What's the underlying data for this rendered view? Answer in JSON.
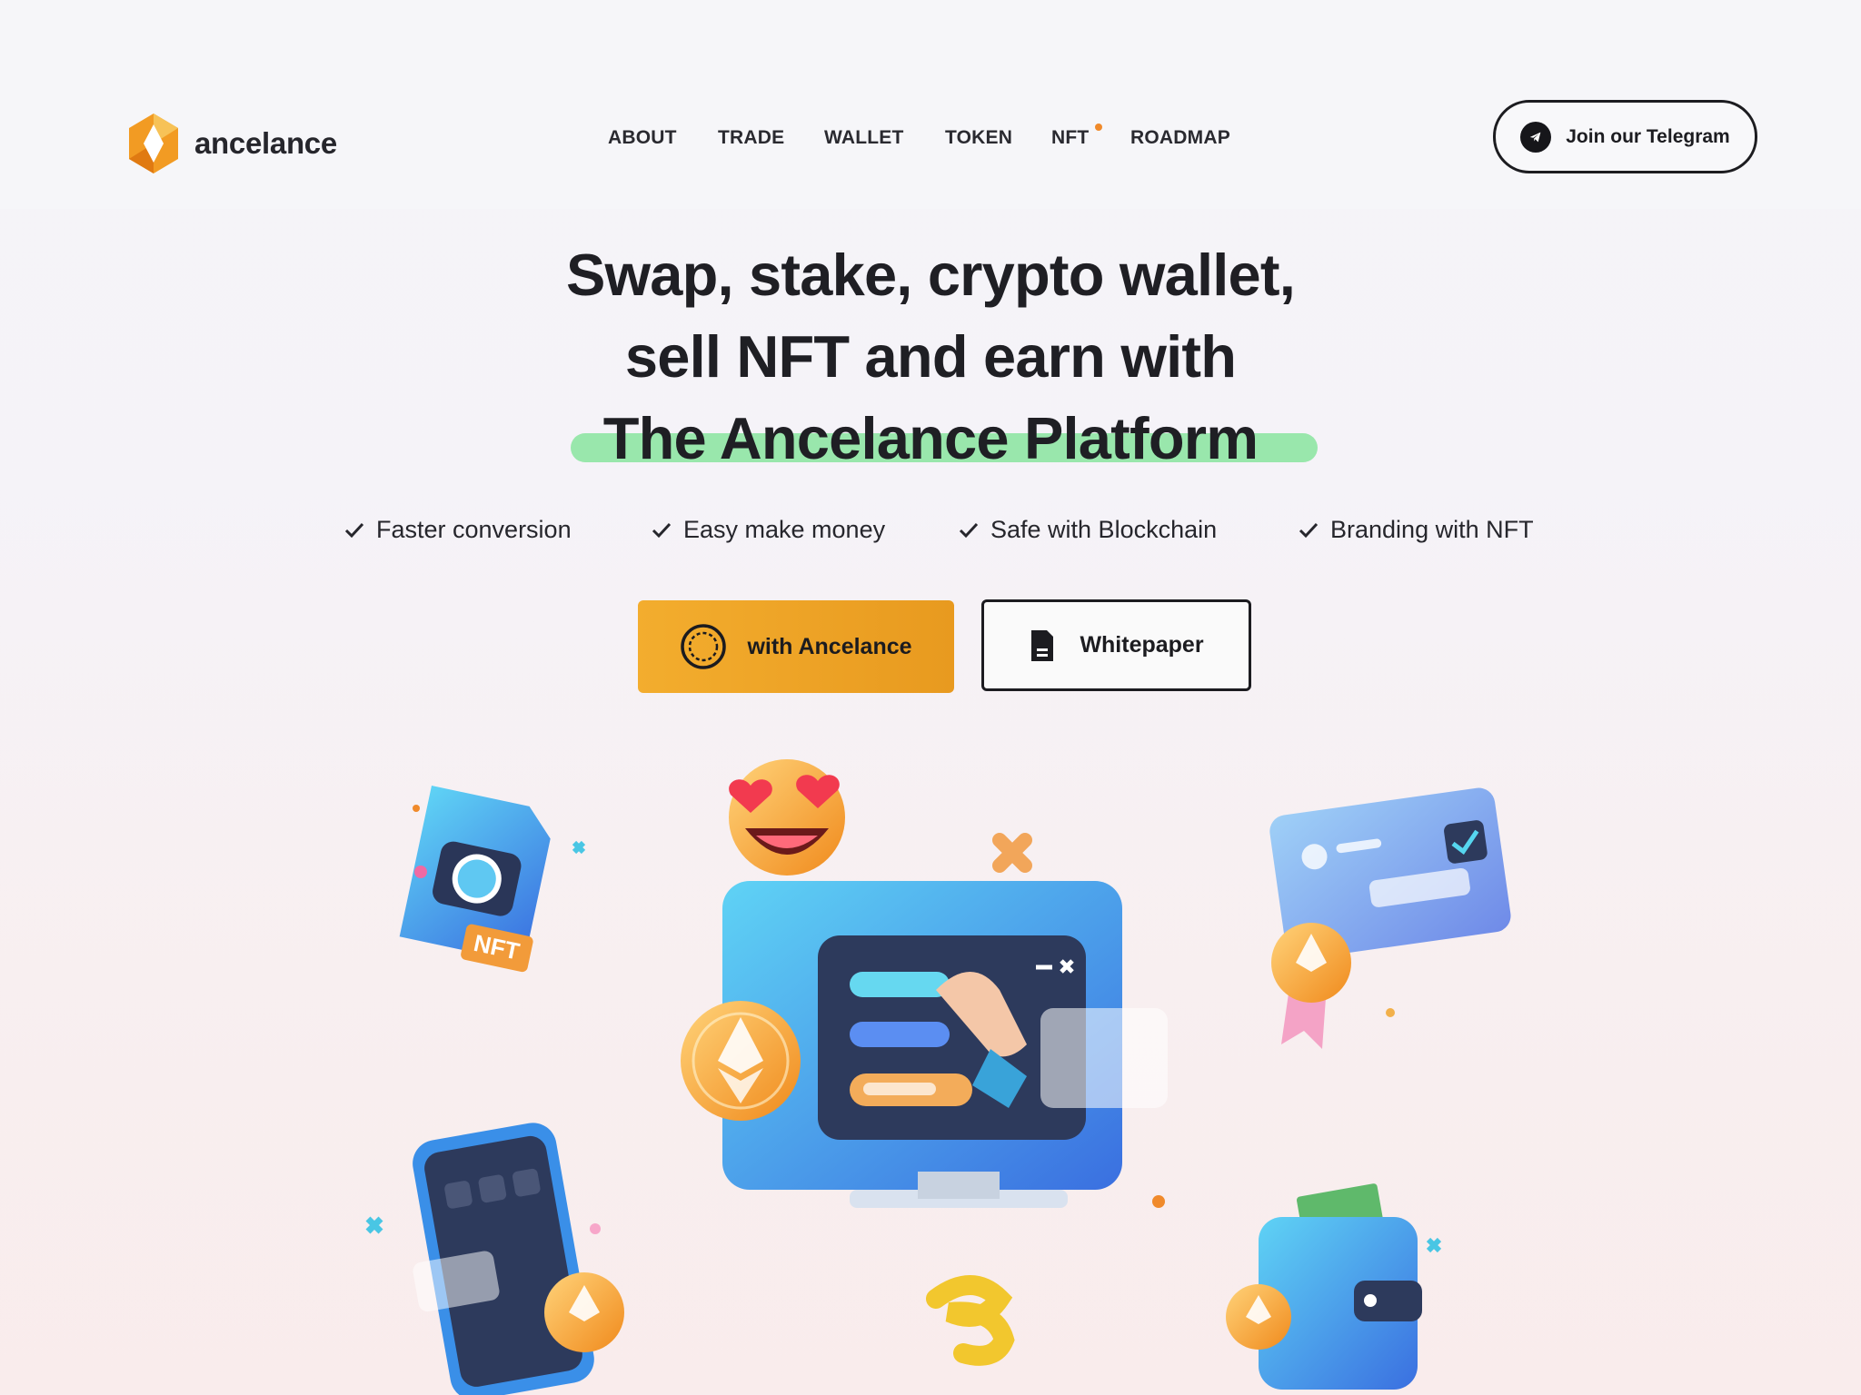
{
  "header": {
    "brand": "ancelance",
    "nav": [
      "ABOUT",
      "TRADE",
      "WALLET",
      "TOKEN",
      "NFT",
      "ROADMAP"
    ],
    "cta": "Join our Telegram"
  },
  "hero": {
    "title_line1": "Swap, stake, crypto wallet,",
    "title_line2": "sell NFT and earn with",
    "title_line3": "The Ancelance Platform",
    "features": [
      "Faster conversion",
      "Easy make money",
      "Safe with Blockchain",
      "Branding with NFT"
    ],
    "primary_button": "with Ancelance",
    "secondary_button": "Whitepaper"
  },
  "illustration": {
    "nft_badge": "NFT"
  },
  "colors": {
    "accent": "#f0a126",
    "highlight": "#8fe6a3",
    "text": "#1f1f24"
  }
}
